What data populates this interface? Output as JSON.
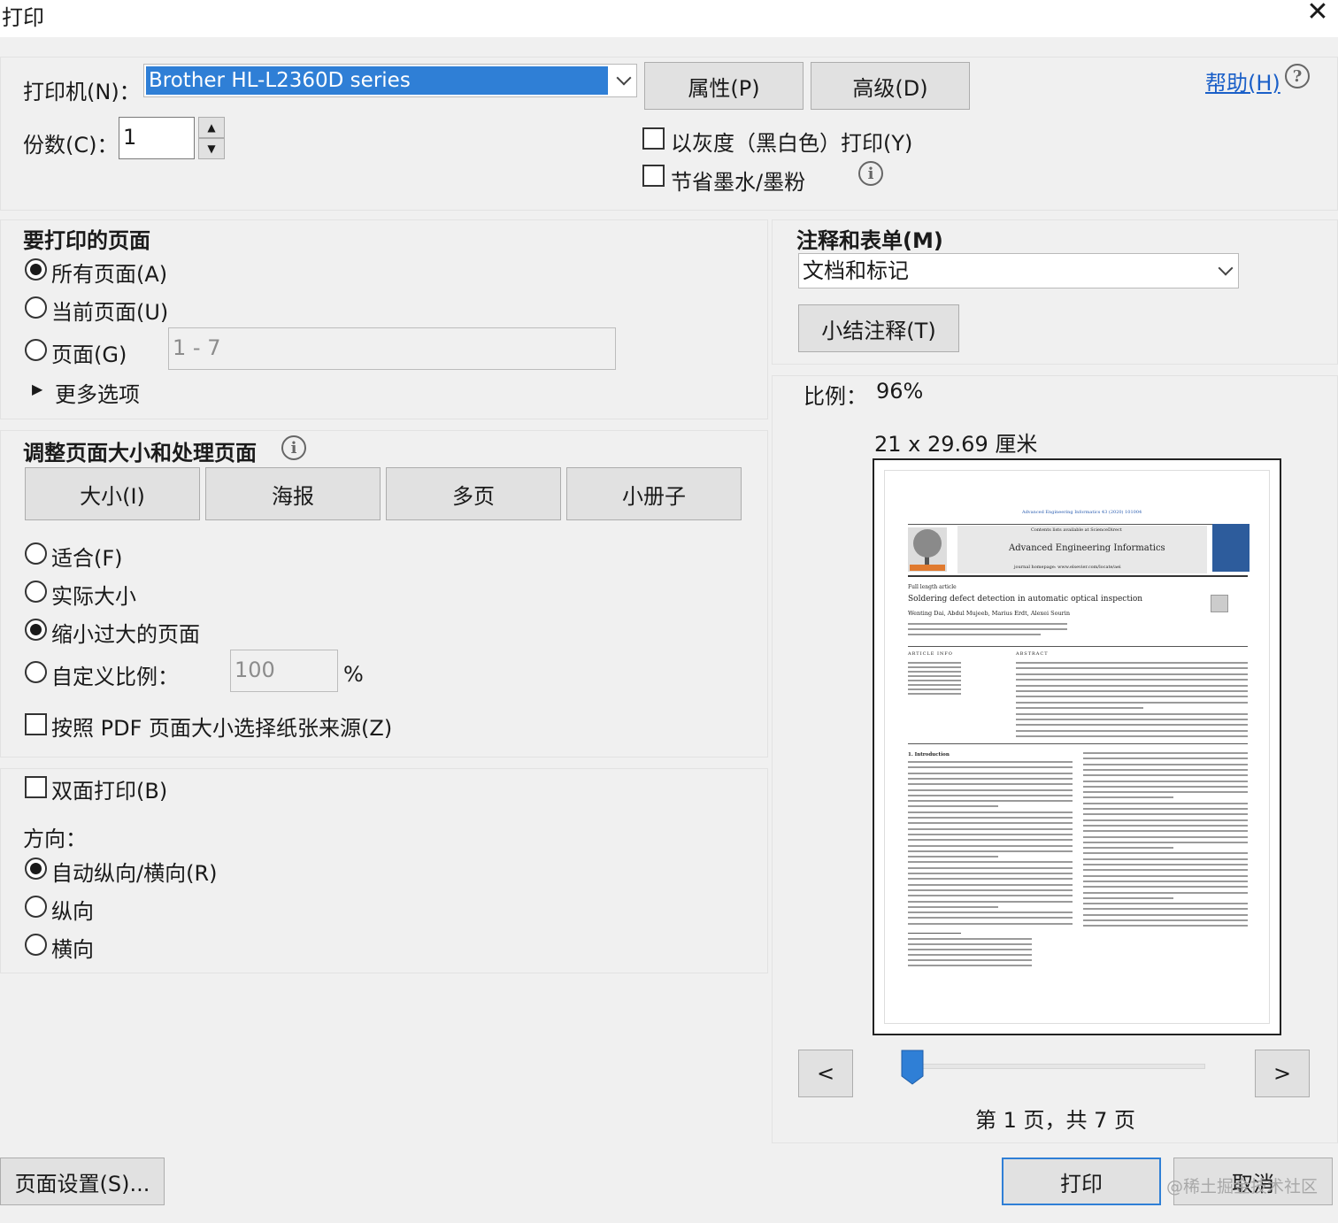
{
  "window": {
    "title": "打印"
  },
  "printer": {
    "label": "打印机(N)：",
    "selected": "Brother HL-L2360D series",
    "properties_button": "属性(P)",
    "advanced_button": "高级(D)",
    "help_link": "帮助(H)"
  },
  "copies": {
    "label": "份数(C)：",
    "value": "1"
  },
  "options": {
    "grayscale": "以灰度（黑白色）打印(Y)",
    "save_ink": "节省墨水/墨粉"
  },
  "pages_to_print": {
    "heading": "要打印的页面",
    "all": "所有页面(A)",
    "current": "当前页面(U)",
    "pages": "页面(G)",
    "pages_range": "1 - 7",
    "more_options": "更多选项"
  },
  "sizing": {
    "heading": "调整页面大小和处理页面",
    "tabs": [
      "大小(I)",
      "海报",
      "多页",
      "小册子"
    ],
    "fit": "适合(F)",
    "actual_size": "实际大小",
    "shrink": "缩小过大的页面",
    "custom_scale": "自定义比例：",
    "custom_scale_value": "100",
    "percent": "%",
    "choose_paper": "按照 PDF 页面大小选择纸张来源(Z)"
  },
  "duplex": {
    "label": "双面打印(B)"
  },
  "orientation": {
    "heading": "方向：",
    "auto": "自动纵向/横向(R)",
    "portrait": "纵向",
    "landscape": "横向"
  },
  "annotations": {
    "heading": "注释和表单(M)",
    "selected": "文档和标记",
    "summarize_button": "小结注释(T)"
  },
  "preview": {
    "scale_label": "比例：",
    "scale_value": "96%",
    "paper_size": "21 x 29.69 厘米",
    "prev": "<",
    "next": ">",
    "page_indicator": "第 1 页，共 7 页",
    "doc": {
      "journal_ref": "Advanced Engineering Informatics 43 (2020) 101004",
      "contents": "Contents lists available at ScienceDirect",
      "journal": "Advanced Engineering Informatics",
      "homepage": "journal homepage: www.elsevier.com/locate/aei",
      "article_type": "Full length article",
      "article_title": "Soldering defect detection in automatic optical inspection",
      "authors": "Wenting Dai, Abdul Mujeeb, Marius Erdt, Alexei Sourin",
      "article_info": "ARTICLE INFO",
      "abstract": "ABSTRACT",
      "intro": "1. Introduction"
    }
  },
  "footer": {
    "page_setup": "页面设置(S)...",
    "print": "打印",
    "cancel": "取消",
    "watermark": "@稀土掘金技术社区"
  }
}
